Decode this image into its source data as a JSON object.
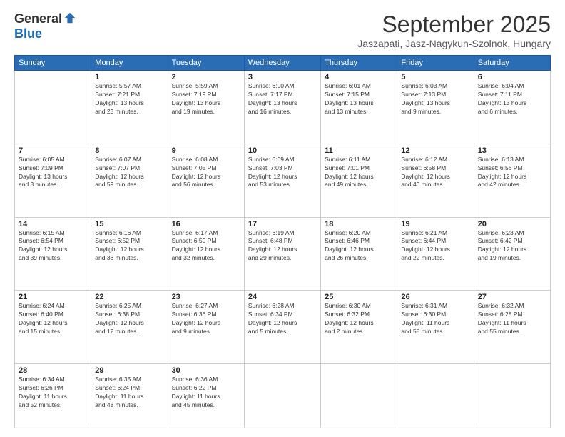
{
  "header": {
    "logo_general": "General",
    "logo_blue": "Blue",
    "month_title": "September 2025",
    "subtitle": "Jaszapati, Jasz-Nagykun-Szolnok, Hungary"
  },
  "weekdays": [
    "Sunday",
    "Monday",
    "Tuesday",
    "Wednesday",
    "Thursday",
    "Friday",
    "Saturday"
  ],
  "weeks": [
    [
      {
        "day": "",
        "info": ""
      },
      {
        "day": "1",
        "info": "Sunrise: 5:57 AM\nSunset: 7:21 PM\nDaylight: 13 hours\nand 23 minutes."
      },
      {
        "day": "2",
        "info": "Sunrise: 5:59 AM\nSunset: 7:19 PM\nDaylight: 13 hours\nand 19 minutes."
      },
      {
        "day": "3",
        "info": "Sunrise: 6:00 AM\nSunset: 7:17 PM\nDaylight: 13 hours\nand 16 minutes."
      },
      {
        "day": "4",
        "info": "Sunrise: 6:01 AM\nSunset: 7:15 PM\nDaylight: 13 hours\nand 13 minutes."
      },
      {
        "day": "5",
        "info": "Sunrise: 6:03 AM\nSunset: 7:13 PM\nDaylight: 13 hours\nand 9 minutes."
      },
      {
        "day": "6",
        "info": "Sunrise: 6:04 AM\nSunset: 7:11 PM\nDaylight: 13 hours\nand 6 minutes."
      }
    ],
    [
      {
        "day": "7",
        "info": "Sunrise: 6:05 AM\nSunset: 7:09 PM\nDaylight: 13 hours\nand 3 minutes."
      },
      {
        "day": "8",
        "info": "Sunrise: 6:07 AM\nSunset: 7:07 PM\nDaylight: 12 hours\nand 59 minutes."
      },
      {
        "day": "9",
        "info": "Sunrise: 6:08 AM\nSunset: 7:05 PM\nDaylight: 12 hours\nand 56 minutes."
      },
      {
        "day": "10",
        "info": "Sunrise: 6:09 AM\nSunset: 7:03 PM\nDaylight: 12 hours\nand 53 minutes."
      },
      {
        "day": "11",
        "info": "Sunrise: 6:11 AM\nSunset: 7:01 PM\nDaylight: 12 hours\nand 49 minutes."
      },
      {
        "day": "12",
        "info": "Sunrise: 6:12 AM\nSunset: 6:58 PM\nDaylight: 12 hours\nand 46 minutes."
      },
      {
        "day": "13",
        "info": "Sunrise: 6:13 AM\nSunset: 6:56 PM\nDaylight: 12 hours\nand 42 minutes."
      }
    ],
    [
      {
        "day": "14",
        "info": "Sunrise: 6:15 AM\nSunset: 6:54 PM\nDaylight: 12 hours\nand 39 minutes."
      },
      {
        "day": "15",
        "info": "Sunrise: 6:16 AM\nSunset: 6:52 PM\nDaylight: 12 hours\nand 36 minutes."
      },
      {
        "day": "16",
        "info": "Sunrise: 6:17 AM\nSunset: 6:50 PM\nDaylight: 12 hours\nand 32 minutes."
      },
      {
        "day": "17",
        "info": "Sunrise: 6:19 AM\nSunset: 6:48 PM\nDaylight: 12 hours\nand 29 minutes."
      },
      {
        "day": "18",
        "info": "Sunrise: 6:20 AM\nSunset: 6:46 PM\nDaylight: 12 hours\nand 26 minutes."
      },
      {
        "day": "19",
        "info": "Sunrise: 6:21 AM\nSunset: 6:44 PM\nDaylight: 12 hours\nand 22 minutes."
      },
      {
        "day": "20",
        "info": "Sunrise: 6:23 AM\nSunset: 6:42 PM\nDaylight: 12 hours\nand 19 minutes."
      }
    ],
    [
      {
        "day": "21",
        "info": "Sunrise: 6:24 AM\nSunset: 6:40 PM\nDaylight: 12 hours\nand 15 minutes."
      },
      {
        "day": "22",
        "info": "Sunrise: 6:25 AM\nSunset: 6:38 PM\nDaylight: 12 hours\nand 12 minutes."
      },
      {
        "day": "23",
        "info": "Sunrise: 6:27 AM\nSunset: 6:36 PM\nDaylight: 12 hours\nand 9 minutes."
      },
      {
        "day": "24",
        "info": "Sunrise: 6:28 AM\nSunset: 6:34 PM\nDaylight: 12 hours\nand 5 minutes."
      },
      {
        "day": "25",
        "info": "Sunrise: 6:30 AM\nSunset: 6:32 PM\nDaylight: 12 hours\nand 2 minutes."
      },
      {
        "day": "26",
        "info": "Sunrise: 6:31 AM\nSunset: 6:30 PM\nDaylight: 11 hours\nand 58 minutes."
      },
      {
        "day": "27",
        "info": "Sunrise: 6:32 AM\nSunset: 6:28 PM\nDaylight: 11 hours\nand 55 minutes."
      }
    ],
    [
      {
        "day": "28",
        "info": "Sunrise: 6:34 AM\nSunset: 6:26 PM\nDaylight: 11 hours\nand 52 minutes."
      },
      {
        "day": "29",
        "info": "Sunrise: 6:35 AM\nSunset: 6:24 PM\nDaylight: 11 hours\nand 48 minutes."
      },
      {
        "day": "30",
        "info": "Sunrise: 6:36 AM\nSunset: 6:22 PM\nDaylight: 11 hours\nand 45 minutes."
      },
      {
        "day": "",
        "info": ""
      },
      {
        "day": "",
        "info": ""
      },
      {
        "day": "",
        "info": ""
      },
      {
        "day": "",
        "info": ""
      }
    ]
  ]
}
